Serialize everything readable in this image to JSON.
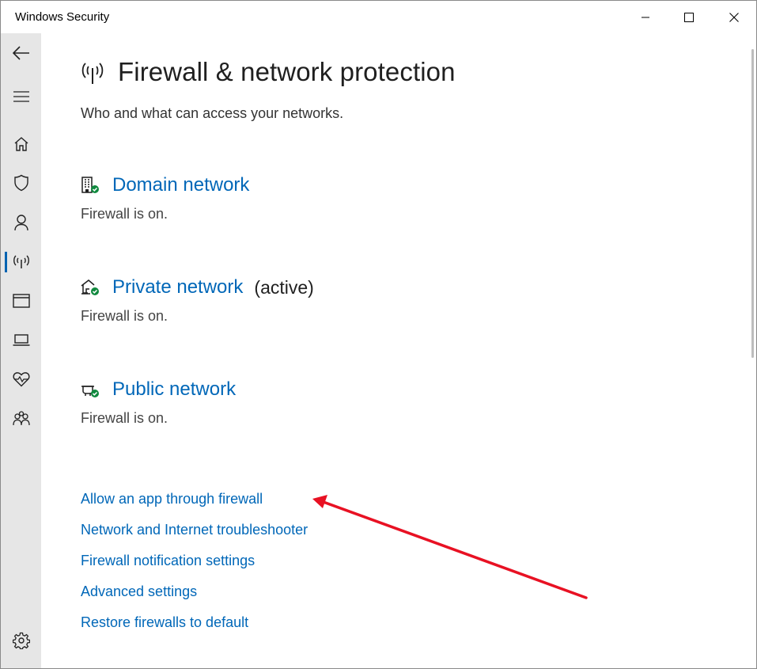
{
  "window": {
    "title": "Windows Security",
    "controls": [
      "minimize",
      "maximize",
      "close"
    ]
  },
  "sidebar": {
    "items": [
      {
        "name": "back",
        "icon": "back-arrow-icon"
      },
      {
        "name": "menu",
        "icon": "hamburger-icon"
      },
      {
        "name": "home",
        "icon": "home-icon"
      },
      {
        "name": "virus-protection",
        "icon": "shield-icon"
      },
      {
        "name": "account-protection",
        "icon": "person-icon"
      },
      {
        "name": "firewall",
        "icon": "antenna-icon",
        "active": true
      },
      {
        "name": "app-browser-control",
        "icon": "window-icon"
      },
      {
        "name": "device-security",
        "icon": "laptop-icon"
      },
      {
        "name": "device-performance",
        "icon": "heart-icon"
      },
      {
        "name": "family-options",
        "icon": "family-icon"
      },
      {
        "name": "settings",
        "icon": "gear-icon"
      }
    ]
  },
  "page": {
    "title": "Firewall & network protection",
    "subtitle": "Who and what can access your networks."
  },
  "networks": [
    {
      "label": "Domain network",
      "status": "Firewall is on.",
      "icon": "domain-network-icon",
      "active_label": ""
    },
    {
      "label": "Private network",
      "status": "Firewall is on.",
      "icon": "private-network-icon",
      "active_label": "(active)"
    },
    {
      "label": "Public network",
      "status": "Firewall is on.",
      "icon": "public-network-icon",
      "active_label": ""
    }
  ],
  "links": [
    "Allow an app through firewall",
    "Network and Internet troubleshooter",
    "Firewall notification settings",
    "Advanced settings",
    "Restore firewalls to default"
  ],
  "colors": {
    "accent": "#0067b8",
    "sidebar_bg": "#e6e6e6",
    "status_ok": "#10893e",
    "annotation_arrow": "#e81123"
  }
}
